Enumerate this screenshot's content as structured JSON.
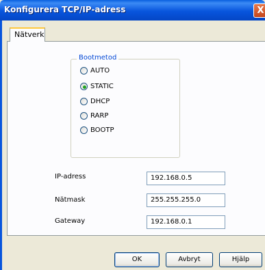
{
  "window": {
    "title": "Konfigurera TCP/IP-adress",
    "close_glyph": "X"
  },
  "tabs": [
    {
      "label": "Nätverk",
      "selected": true
    }
  ],
  "boot_method": {
    "legend": "Bootmetod",
    "options": [
      {
        "label": "AUTO",
        "selected": false
      },
      {
        "label": "STATIC",
        "selected": true
      },
      {
        "label": "DHCP",
        "selected": false
      },
      {
        "label": "RARP",
        "selected": false
      },
      {
        "label": "BOOTP",
        "selected": false
      }
    ]
  },
  "fields": {
    "ip": {
      "label": "IP-adress",
      "value": "192.168.0.5"
    },
    "netmask": {
      "label": "Nätmask",
      "value": "255.255.255.0"
    },
    "gateway": {
      "label": "Gateway",
      "value": "192.168.0.1"
    }
  },
  "buttons": {
    "ok": "OK",
    "cancel": "Avbryt",
    "help": "Hjälp"
  },
  "colors": {
    "titlebar": "#0855dd",
    "window_bg": "#ece9d8",
    "accent_legend": "#0046d5",
    "radio_selected": "#21a121"
  }
}
